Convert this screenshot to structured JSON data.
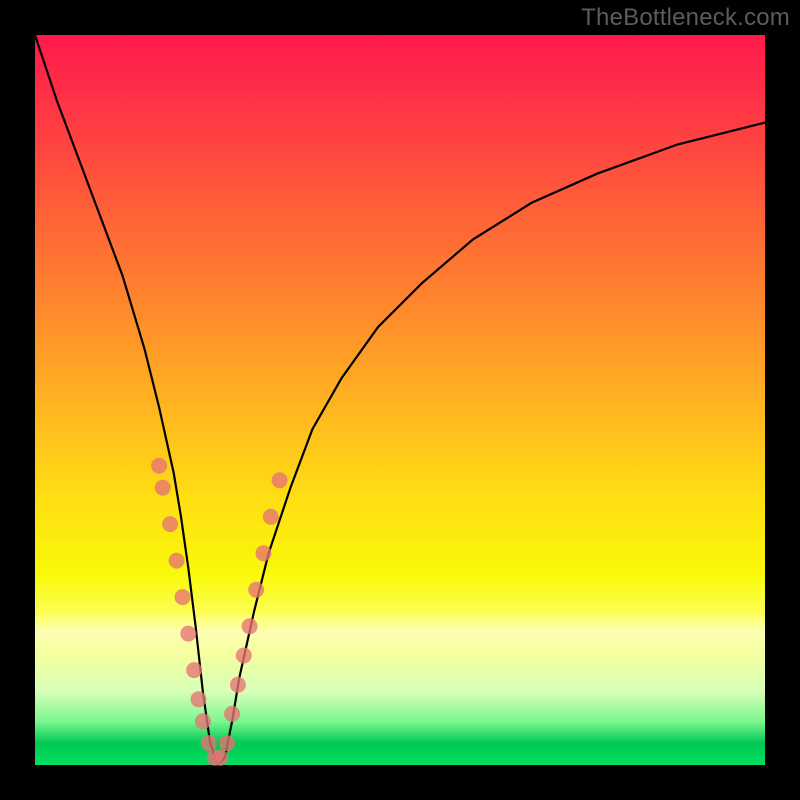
{
  "watermark": "TheBottleneck.com",
  "chart_data": {
    "type": "line",
    "title": "",
    "xlabel": "",
    "ylabel": "",
    "xlim": [
      0,
      100
    ],
    "ylim": [
      0,
      100
    ],
    "grid": false,
    "legend": false,
    "background_gradient": {
      "stops": [
        {
          "pos": 0,
          "color": "#ff1a4b"
        },
        {
          "pos": 22,
          "color": "#ff5a3a"
        },
        {
          "pos": 52,
          "color": "#ffb81f"
        },
        {
          "pos": 74,
          "color": "#f9f90a"
        },
        {
          "pos": 94,
          "color": "#7cf78f"
        },
        {
          "pos": 100,
          "color": "#00e060"
        }
      ]
    },
    "series": [
      {
        "name": "bottleneck-curve",
        "color": "#000000",
        "x": [
          0,
          3,
          6,
          9,
          12,
          15,
          17,
          19,
          20,
          21,
          22,
          23,
          24,
          25,
          26,
          27,
          28,
          30,
          32,
          35,
          38,
          42,
          47,
          53,
          60,
          68,
          77,
          88,
          100
        ],
        "y": [
          100,
          91,
          83,
          75,
          67,
          57,
          49,
          40,
          34,
          27,
          19,
          10,
          3,
          0,
          1,
          6,
          12,
          21,
          29,
          38,
          46,
          53,
          60,
          66,
          72,
          77,
          81,
          85,
          88
        ]
      }
    ],
    "scatter": {
      "name": "sample-points",
      "color": "#e57373",
      "points": [
        {
          "x": 17.0,
          "y": 41
        },
        {
          "x": 17.5,
          "y": 38
        },
        {
          "x": 18.5,
          "y": 33
        },
        {
          "x": 19.4,
          "y": 28
        },
        {
          "x": 20.2,
          "y": 23
        },
        {
          "x": 21.0,
          "y": 18
        },
        {
          "x": 21.8,
          "y": 13
        },
        {
          "x": 22.4,
          "y": 9
        },
        {
          "x": 23.0,
          "y": 6
        },
        {
          "x": 23.8,
          "y": 3
        },
        {
          "x": 24.6,
          "y": 1
        },
        {
          "x": 25.4,
          "y": 1
        },
        {
          "x": 26.3,
          "y": 3
        },
        {
          "x": 27.0,
          "y": 7
        },
        {
          "x": 27.8,
          "y": 11
        },
        {
          "x": 28.6,
          "y": 15
        },
        {
          "x": 29.4,
          "y": 19
        },
        {
          "x": 30.3,
          "y": 24
        },
        {
          "x": 31.3,
          "y": 29
        },
        {
          "x": 32.3,
          "y": 34
        },
        {
          "x": 33.5,
          "y": 39
        }
      ]
    }
  }
}
